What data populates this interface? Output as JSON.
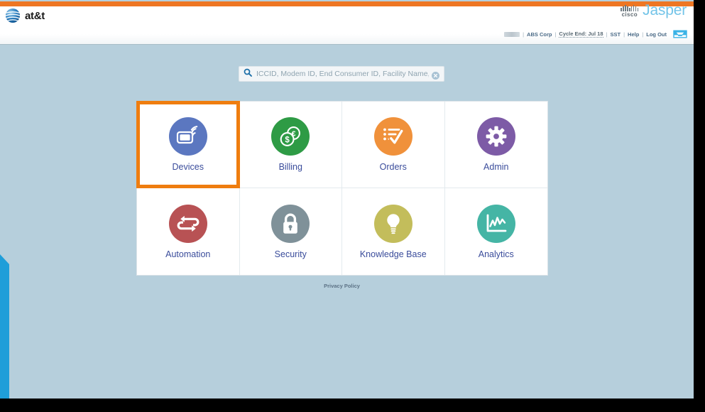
{
  "brand": {
    "att_name": "at&t",
    "att_logo_icon": "att-globe-icon",
    "cisco_name": "cisco",
    "jasper_name": "Jasper"
  },
  "header": {
    "utility_nav": {
      "account_name": "ABS Corp",
      "cycle_end": "Cycle End: Jul 18",
      "sst": "SST",
      "help": "Help",
      "log_out": "Log Out",
      "separator": "|",
      "inbox_icon": "inbox-tray-icon"
    }
  },
  "search": {
    "icon": "search-icon",
    "placeholder": "ICCID, Modem ID, End Consumer ID, Facility Name, O",
    "value": "",
    "clear_icon": "clear-circle-icon"
  },
  "tiles": [
    {
      "label": "Devices",
      "icon": "device-wireless-icon",
      "color": "#5b77c0",
      "selected": true
    },
    {
      "label": "Billing",
      "icon": "coins-currency-icon",
      "color": "#2e9b45",
      "selected": false
    },
    {
      "label": "Orders",
      "icon": "checklist-check-icon",
      "color": "#f0913b",
      "selected": false
    },
    {
      "label": "Admin",
      "icon": "gear-icon",
      "color": "#7d5ba6",
      "selected": false
    },
    {
      "label": "Automation",
      "icon": "cycle-arrows-icon",
      "color": "#b85254",
      "selected": false
    },
    {
      "label": "Security",
      "icon": "padlock-icon",
      "color": "#7f9199",
      "selected": false
    },
    {
      "label": "Knowledge Base",
      "icon": "lightbulb-icon",
      "color": "#c3bd5b",
      "selected": false
    },
    {
      "label": "Analytics",
      "icon": "line-chart-icon",
      "color": "#45b5a5",
      "selected": false
    }
  ],
  "footer": {
    "privacy_policy": "Privacy Policy"
  },
  "theme": {
    "accent_orange": "#ee7623",
    "selection_orange": "#ef7d0f",
    "page_background": "#b6cfdc",
    "left_flag_blue": "#1f9ed9",
    "label_blue": "#3a4c9b"
  }
}
